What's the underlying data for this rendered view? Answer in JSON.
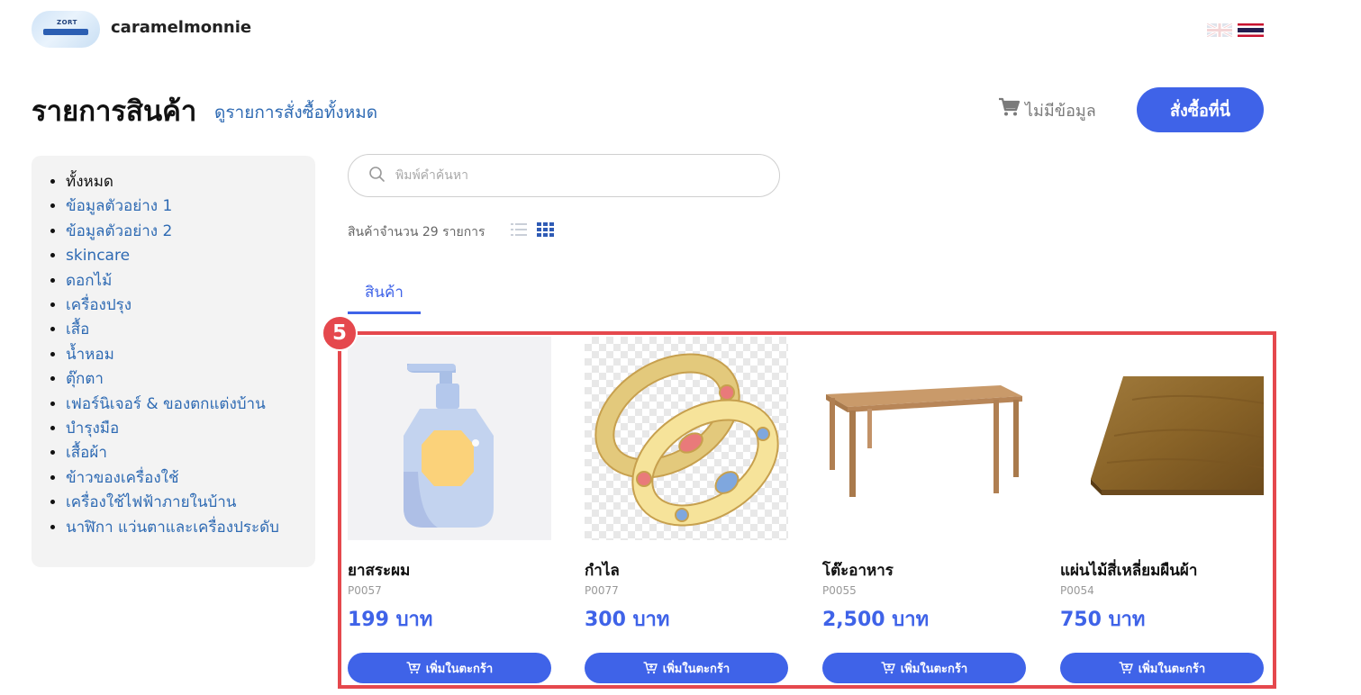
{
  "header": {
    "logo_text": "ZORT",
    "shop_name": "caramelmonnie",
    "languages": [
      "en-flag",
      "th-flag"
    ]
  },
  "page": {
    "title": "รายการสินค้า",
    "orders_link": "ดูรายการสั่งซื้อทั้งหมด",
    "cart_status": "ไม่มีข้อมูล",
    "order_button": "สั่งซื้อที่นี่"
  },
  "sidebar": {
    "items": [
      {
        "label": "ทั้งหมด"
      },
      {
        "label": "ข้อมูลตัวอย่าง 1"
      },
      {
        "label": "ข้อมูลตัวอย่าง 2"
      },
      {
        "label": "skincare"
      },
      {
        "label": "ดอกไม้"
      },
      {
        "label": "เครื่องปรุง"
      },
      {
        "label": "เสื้อ"
      },
      {
        "label": "น้ำหอม"
      },
      {
        "label": "ตุ๊กตา"
      },
      {
        "label": "เฟอร์นิเจอร์ & ของตกแต่งบ้าน"
      },
      {
        "label": "บำรุงมือ"
      },
      {
        "label": "เสื้อผ้า"
      },
      {
        "label": "ข้าวของเครื่องใช้"
      },
      {
        "label": "เครื่องใช้ไฟฟ้าภายในบ้าน"
      },
      {
        "label": "นาฬิกา แว่นตาและเครื่องประดับ"
      }
    ]
  },
  "search": {
    "placeholder": "พิมพ์คำค้นหา",
    "value": ""
  },
  "listing": {
    "count_text": "สินค้าจำนวน 29 รายการ",
    "tab_label": "สินค้า"
  },
  "annotation": {
    "badge": "5",
    "color": "#e5484d"
  },
  "products": [
    {
      "name": "ยาสระผม",
      "sku": "P0057",
      "price": "199 บาท",
      "button": "เพิ่มในตะกร้า",
      "image": "shampoo-bottle"
    },
    {
      "name": "กำไล",
      "sku": "P0077",
      "price": "300 บาท",
      "button": "เพิ่มในตะกร้า",
      "image": "gold-bangles"
    },
    {
      "name": "โต๊ะอาหาร",
      "sku": "P0055",
      "price": "2,500 บาท",
      "button": "เพิ่มในตะกร้า",
      "image": "wooden-table"
    },
    {
      "name": "แผ่นไม้สี่เหลี่ยมผืนผ้า",
      "sku": "P0054",
      "price": "750 บาท",
      "button": "เพิ่มในตะกร้า",
      "image": "wood-board"
    }
  ],
  "colors": {
    "accent": "#3f63e8",
    "link": "#2e6ab3",
    "highlight": "#e5484d"
  }
}
